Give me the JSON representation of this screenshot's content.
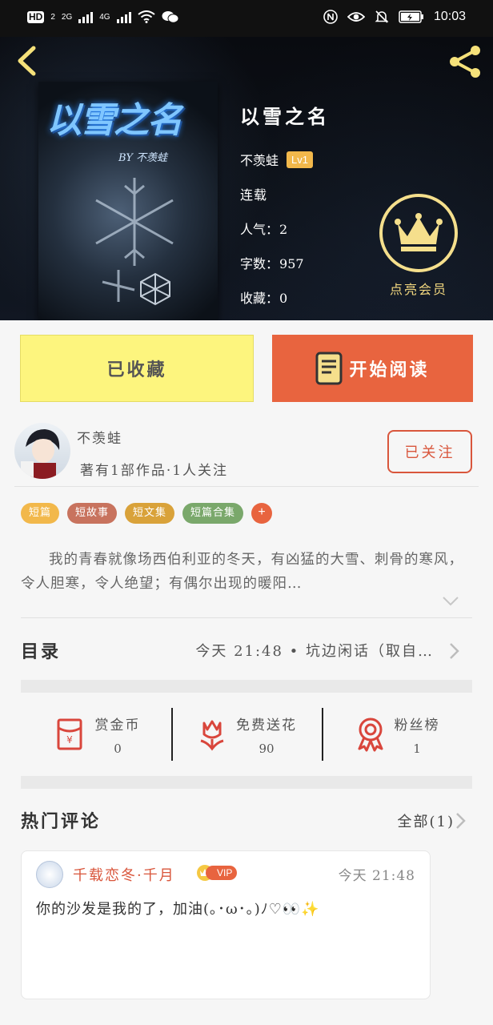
{
  "status_bar": {
    "network_badge": "HD",
    "network_sub": "2",
    "signal_1_type": "2G",
    "signal_2_type": "4G",
    "time": "10:03"
  },
  "book": {
    "cover_title": "以雪之名",
    "cover_author": "BY 不羡蛙",
    "title": "以雪之名",
    "author": "不羡蛙",
    "level": "Lv1",
    "status": "连载",
    "popularity_label": "人气",
    "popularity": "2",
    "word_count_label": "字数",
    "word_count": "957",
    "collect_label": "收藏",
    "collect_count": "0"
  },
  "vip": {
    "label": "点亮会员"
  },
  "actions": {
    "collected_label": "已收藏",
    "read_label": "开始阅读"
  },
  "author_card": {
    "name": "不羡蛙",
    "stats": "著有1部作品·1人关注",
    "follow_label": "已关注"
  },
  "tags": [
    {
      "label": "短篇",
      "color": "#f2b84b"
    },
    {
      "label": "短故事",
      "color": "#c8735e"
    },
    {
      "label": "短文集",
      "color": "#d9a23a"
    },
    {
      "label": "短篇合集",
      "color": "#7aa86b"
    }
  ],
  "tag_add": "+",
  "synopsis": "我的青春就像场西伯利亚的冬天，有凶猛的大雪、刺骨的寒风，令人胆寒，令人绝望；有偶尔出现的暖阳…",
  "toc": {
    "title": "目录",
    "latest": "今天 21:48 • 坑边闲话（取自…"
  },
  "stats": [
    {
      "label": "赏金币",
      "value": "0",
      "icon": "red-envelope-icon"
    },
    {
      "label": "免费送花",
      "value": "90",
      "icon": "flower-icon"
    },
    {
      "label": "粉丝榜",
      "value": "1",
      "icon": "medal-icon"
    }
  ],
  "comments_section": {
    "title": "热门评论",
    "all_label": "全部(1)"
  },
  "comment": {
    "user": "千载恋冬·千月",
    "vip_badge": "VIP",
    "time": "今天 21:48",
    "text": "你的沙发是我的了，加油(｡･ω･｡)ﾉ♡👀✨"
  },
  "colors": {
    "accent": "#e8643f",
    "collected_bg": "#fdf57e",
    "vip_gold": "#f5df8c"
  }
}
